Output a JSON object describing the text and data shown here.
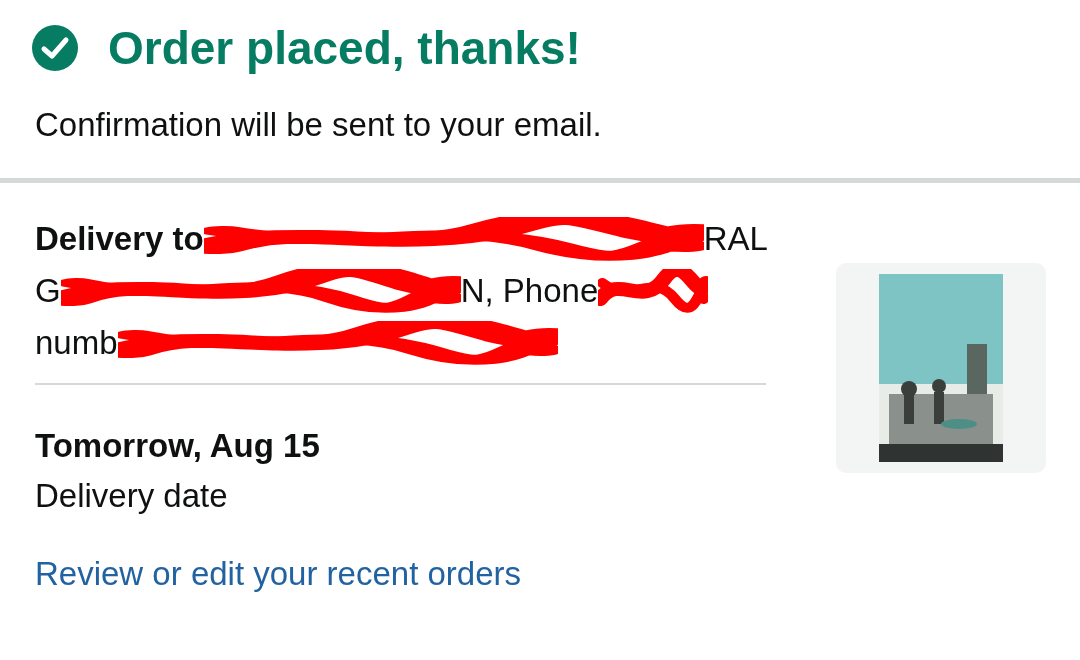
{
  "header": {
    "confirmed": true,
    "title": "Order placed, thanks!",
    "subtitle": "Confirmation will be sent to your email."
  },
  "delivery": {
    "address_lines": [
      {
        "segments": [
          {
            "kind": "text",
            "text": "Delivery to",
            "bold": true
          },
          {
            "kind": "redacted"
          },
          {
            "kind": "text",
            "text": "RAL",
            "bold": false
          }
        ]
      },
      {
        "segments": [
          {
            "kind": "text",
            "text": "G",
            "bold": false
          },
          {
            "kind": "redacted"
          },
          {
            "kind": "text",
            "text": "N, Phone",
            "bold": false
          },
          {
            "kind": "redacted"
          }
        ]
      },
      {
        "segments": [
          {
            "kind": "text",
            "text": "numb",
            "bold": false
          },
          {
            "kind": "redacted"
          }
        ]
      }
    ],
    "date": "Tomorrow, Aug 15",
    "date_label": "Delivery date"
  },
  "link": "Review or edit your recent orders"
}
